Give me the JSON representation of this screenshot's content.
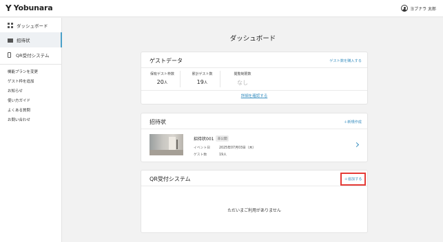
{
  "header": {
    "logo_mark": "Y",
    "logo_text": "Yobunara",
    "user_name": "ヨブナラ 太郎",
    "user_icon": "user-circle-icon"
  },
  "sidebar": {
    "items": [
      {
        "label": "ダッシュボード",
        "icon": "grid-icon",
        "active": false
      },
      {
        "label": "招待状",
        "icon": "mail-icon",
        "active": true
      },
      {
        "label": "QR受付システム",
        "icon": "phone-icon",
        "active": false
      }
    ],
    "links": [
      "機能プランを変更",
      "ゲスト枠を追加",
      "お知らせ",
      "使い方ガイド",
      "よくある質問",
      "お問い合わせ"
    ]
  },
  "main": {
    "title": "ダッシュボード",
    "guest_data": {
      "title": "ゲストデータ",
      "action": "ゲスト数を購入する",
      "stats": [
        {
          "label": "保有ゲスト枠数",
          "value": "20",
          "unit": "人"
        },
        {
          "label": "累計ゲスト数",
          "value": "19",
          "unit": "人"
        },
        {
          "label": "閲覧制限数",
          "value": "なし",
          "unit": ""
        }
      ],
      "detail_link": "詳細を確認する"
    },
    "invitation": {
      "title": "招待状",
      "action": "＋新規作成",
      "item": {
        "name": "招待状001",
        "badge": "非公開",
        "event_date_label": "イベント日",
        "event_date_value": "2025年07月03日（木）",
        "guest_count_label": "ゲスト数",
        "guest_count_value": "19人"
      }
    },
    "qr_system": {
      "title": "QR受付システム",
      "action": "＋追加する",
      "empty_text": "ただいまご利用がありません"
    }
  },
  "colors": {
    "accent": "#3a8fc0",
    "highlight_border": "#e53935",
    "active_nav_bg": "#eef1f4"
  }
}
